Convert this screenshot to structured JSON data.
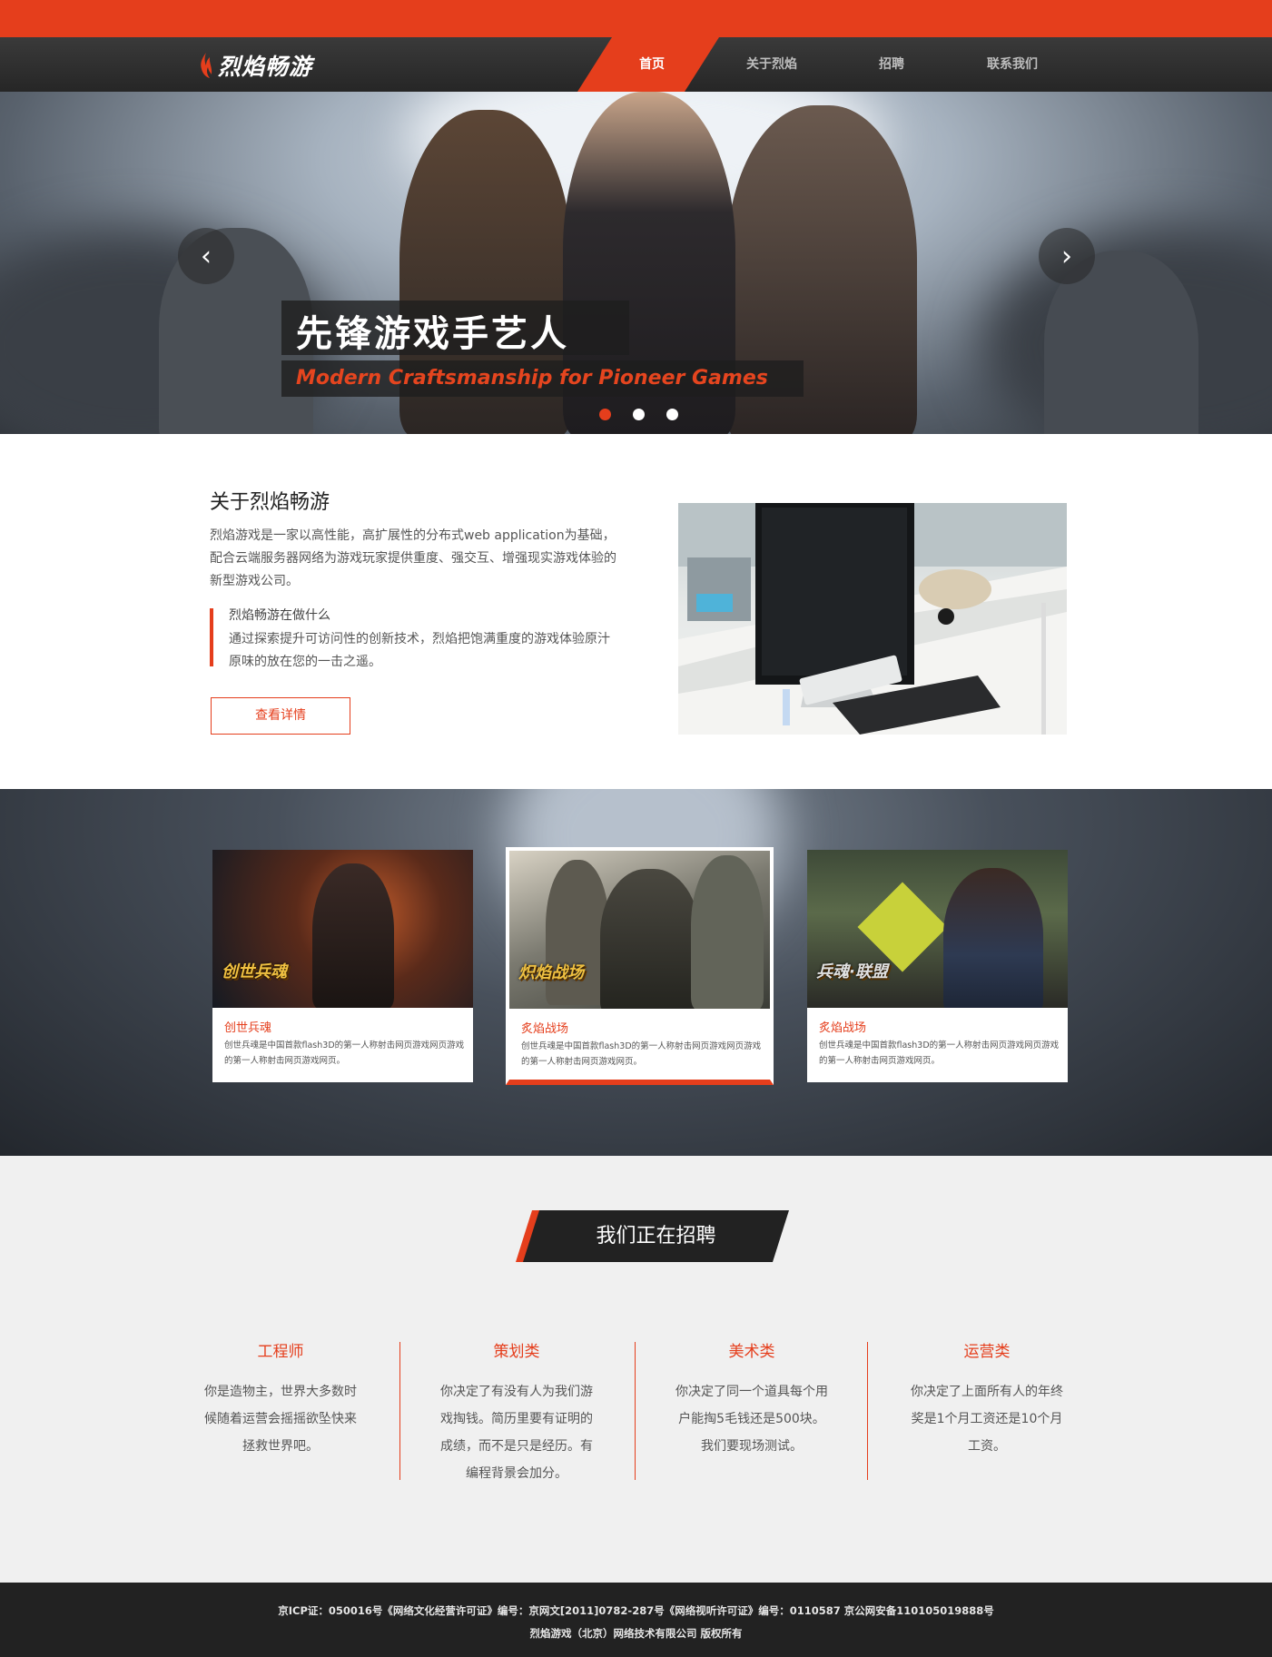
{
  "brand": {
    "name": "烈焰畅游",
    "accent": "#e53e1c"
  },
  "nav": {
    "items": [
      {
        "label": "首页",
        "active": true
      },
      {
        "label": "关于烈焰",
        "active": false
      },
      {
        "label": "招聘",
        "active": false
      },
      {
        "label": "联系我们",
        "active": false
      }
    ]
  },
  "hero": {
    "title": "先锋游戏手艺人",
    "subtitle": "Modern Craftsmanship for Pioneer Games",
    "prev_icon": "chevron-left-icon",
    "next_icon": "chevron-right-icon",
    "prev_glyph": "‹",
    "next_glyph": "›",
    "active_slide": 1,
    "slide_count": 3
  },
  "about": {
    "title": "关于烈焰畅游",
    "description": "烈焰游戏是一家以高性能，高扩展性的分布式web application为基础，配合云端服务器网络为游戏玩家提供重度、强交互、增强现实游戏体验的新型游戏公司。",
    "quote_title": "烈焰畅游在做什么",
    "quote_text": "通过探索提升可访问性的创新技术，烈焰把饱满重度的游戏体验原汁原味的放在您的一击之遥。",
    "button_label": "查看详情"
  },
  "games": [
    {
      "name": "创世兵魂",
      "logo": "创世兵魂",
      "description": "创世兵魂是中国首款flash3D的第一人称射击网页游戏网页游戏的第一人称射击网页游戏网页。",
      "featured": false
    },
    {
      "name": "炙焰战场",
      "logo": "炽焰战场",
      "description": "创世兵魂是中国首款flash3D的第一人称射击网页游戏网页游戏的第一人称射击网页游戏网页。",
      "featured": true
    },
    {
      "name": "炙焰战场",
      "logo": "兵魂·联盟",
      "description": "创世兵魂是中国首款flash3D的第一人称射击网页游戏网页游戏的第一人称射击网页游戏网页。",
      "featured": false
    }
  ],
  "recruit": {
    "title": "我们正在招聘",
    "jobs": [
      {
        "name": "工程师",
        "description": "你是造物主，世界大多数时候随着运营会摇摇欲坠快来拯救世界吧。"
      },
      {
        "name": "策划类",
        "description": "你决定了有没有人为我们游戏掏钱。简历里要有证明的成绩，而不是只是经历。有编程背景会加分。"
      },
      {
        "name": "美术类",
        "description": "你决定了同一个道具每个用户能掏5毛钱还是500块。我们要现场测试。"
      },
      {
        "name": "运营类",
        "description": "你决定了上面所有人的年终奖是1个月工资还是10个月工资。"
      }
    ]
  },
  "footer": {
    "line1": "京ICP证：050016号《网络文化经营许可证》编号：京网文[2011]0782-287号《网络视听许可证》编号：0110587 京公网安备110105019888号",
    "line2": "烈焰游戏（北京）网络技术有限公司 版权所有"
  }
}
